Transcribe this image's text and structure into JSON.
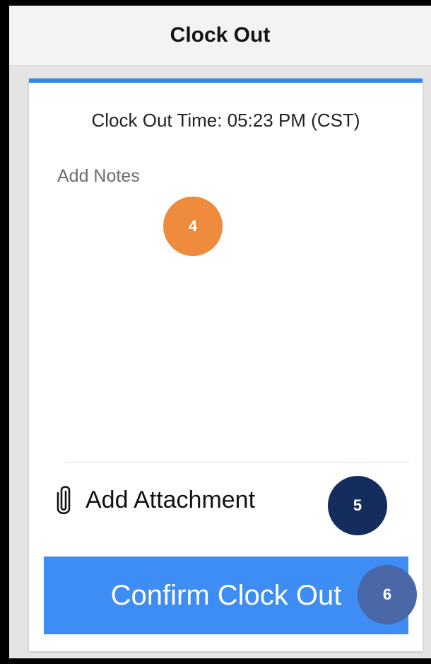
{
  "header": {
    "title": "Clock Out"
  },
  "card": {
    "clock_out_time": "Clock Out Time: 05:23 PM (CST)",
    "notes_placeholder": "Add Notes",
    "attachment_label": "Add Attachment",
    "confirm_label": "Confirm Clock Out"
  },
  "icons": {
    "attachment": "paperclip-icon"
  },
  "colors": {
    "accent": "#2e86f0",
    "button": "#3d8df5",
    "badge_4": "#ef8b3c",
    "badge_5": "#142d5c",
    "badge_6": "#4a67a8"
  },
  "step_badges": {
    "notes": "4",
    "attachment": "5",
    "confirm": "6"
  }
}
